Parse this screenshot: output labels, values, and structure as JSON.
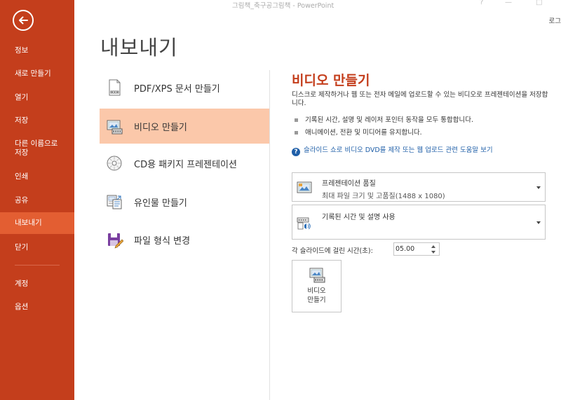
{
  "window": {
    "title": "그림책_축구공그림책 - PowerPoint",
    "help_glyph": "?",
    "minimize_glyph": "—",
    "maximize_glyph": "□",
    "signin_label": "로그"
  },
  "sidebar": {
    "back_icon": "back-arrow-icon",
    "items": [
      {
        "label": "정보",
        "active": false
      },
      {
        "label": "새로 만들기",
        "active": false
      },
      {
        "label": "열기",
        "active": false
      },
      {
        "label": "저장",
        "active": false
      },
      {
        "label": "다른 이름으로\n저장",
        "active": false
      },
      {
        "label": "인쇄",
        "active": false
      },
      {
        "label": "공유",
        "active": false
      },
      {
        "label": "내보내기",
        "active": true
      },
      {
        "label": "닫기",
        "active": false
      },
      {
        "label": "계정",
        "active": false
      },
      {
        "label": "옵션",
        "active": false
      }
    ]
  },
  "page_title": "내보내기",
  "options": [
    {
      "label": "PDF/XPS 문서 만들기",
      "icon": "pdf-document-icon",
      "active": false
    },
    {
      "label": "비디오 만들기",
      "icon": "video-icon",
      "active": true
    },
    {
      "label": "CD용 패키지 프레젠테이션",
      "icon": "cd-package-icon",
      "active": false
    },
    {
      "label": "유인물 만들기",
      "icon": "handout-icon",
      "active": false
    },
    {
      "label": "파일 형식 변경",
      "icon": "change-file-type-icon",
      "active": false
    }
  ],
  "panel": {
    "title": "비디오 만들기",
    "description": "디스크로 제작하거나 웹 또는 전자 메일에 업로드할 수 있는 비디오로 프레젠테이션을 저장합니다.",
    "bullets": [
      "기록된 시간, 설명 및 레이저 포인터 동작을 모두 통합합니다.",
      "애니메이션, 전환 및 미디어를 유지합니다."
    ],
    "help_link": "슬라이드 쇼로 비디오 DVD를 제작 또는 웹 업로드 관련 도움말 보기",
    "quality_dropdown": {
      "main": "프레젠테이션 품질",
      "sub": "최대 파일 크기 및 고품질(1488 x 1080)",
      "icon": "presentation-quality-icon"
    },
    "timing_dropdown": {
      "main": "기록된 시간 및 설명 사용",
      "icon": "timing-narration-icon"
    },
    "time_label": "각 슬라이드에 걸린 시간(초):",
    "time_value": "05.00",
    "make_button": {
      "label": "비디오\n만들기",
      "icon": "create-video-icon"
    }
  },
  "colors": {
    "sidebar_bg": "#c43e1c",
    "sidebar_active": "#e35e32",
    "option_active": "#fbc8aa",
    "accent": "#c43e1c",
    "link": "#1f5fa8"
  }
}
